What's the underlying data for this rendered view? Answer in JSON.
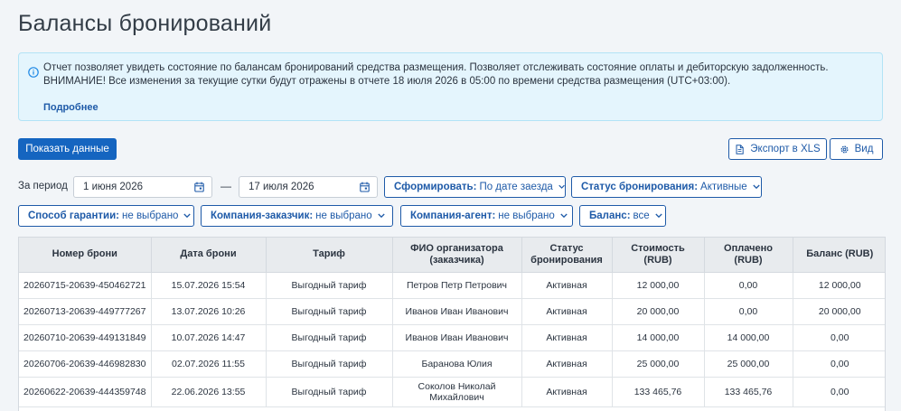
{
  "page_title": "Балансы бронирований",
  "info": {
    "line1": "Отчет позволяет увидеть состояние по балансам бронирований средства размещения. Позволяет отслеживать состояние оплаты и дебиторскую задолженность.",
    "line2": "ВНИМАНИЕ! Все изменения за текущие сутки будут отражены в отчете 18 июля 2026 в 05:00 по времени средства размещения (UTC+03:00).",
    "more_link": "Подробнее"
  },
  "toolbar": {
    "show_data": "Показать данные",
    "export_xls": "Экспорт в XLS",
    "view": "Вид"
  },
  "filters": {
    "period_label": "За период",
    "date_from": "1 июня 2026",
    "date_separator": "—",
    "date_to": "17 июля 2026",
    "form_by_label": "Сформировать:",
    "form_by_value": "По дате заезда",
    "status_label": "Статус бронирования:",
    "status_value": "Активные",
    "guarantee_label": "Способ гарантии:",
    "guarantee_value": "не выбрано",
    "customer_label": "Компания-заказчик:",
    "customer_value": "не выбрано",
    "agent_label": "Компания-агент:",
    "agent_value": "не выбрано",
    "balance_label": "Баланс:",
    "balance_value": "все"
  },
  "table": {
    "headers": [
      "Номер брони",
      "Дата брони",
      "Тариф",
      "ФИО организатора (заказчика)",
      "Статус бронирования",
      "Стоимость (RUB)",
      "Оплачено (RUB)",
      "Баланс (RUB)"
    ],
    "rows": [
      [
        "20260715-20639-450462721",
        "15.07.2026 15:54",
        "Выгодный тариф",
        "Петров Петр Петрович",
        "Активная",
        "12 000,00",
        "0,00",
        "12 000,00"
      ],
      [
        "20260713-20639-449777267",
        "13.07.2026 10:26",
        "Выгодный тариф",
        "Иванов Иван Иванович",
        "Активная",
        "20 000,00",
        "0,00",
        "20 000,00"
      ],
      [
        "20260710-20639-449131849",
        "10.07.2026 14:47",
        "Выгодный тариф",
        "Иванов Иван Иванович",
        "Активная",
        "14 000,00",
        "14 000,00",
        "0,00"
      ],
      [
        "20260706-20639-446982830",
        "02.07.2026 11:55",
        "Выгодный тариф",
        "Баранова Юлия",
        "Активная",
        "25 000,00",
        "25 000,00",
        "0,00"
      ],
      [
        "20260622-20639-444359748",
        "22.06.2026 13:55",
        "Выгодный тариф",
        "Соколов Николай Михайлович",
        "Активная",
        "133 465,76",
        "133 465,76",
        "0,00"
      ]
    ]
  },
  "colors": {
    "primary": "#1565c0",
    "link": "#1e5aa8",
    "info_bg": "#e4f5fd",
    "info_border": "#b3e3f6",
    "header_bg": "#e8ebee"
  }
}
